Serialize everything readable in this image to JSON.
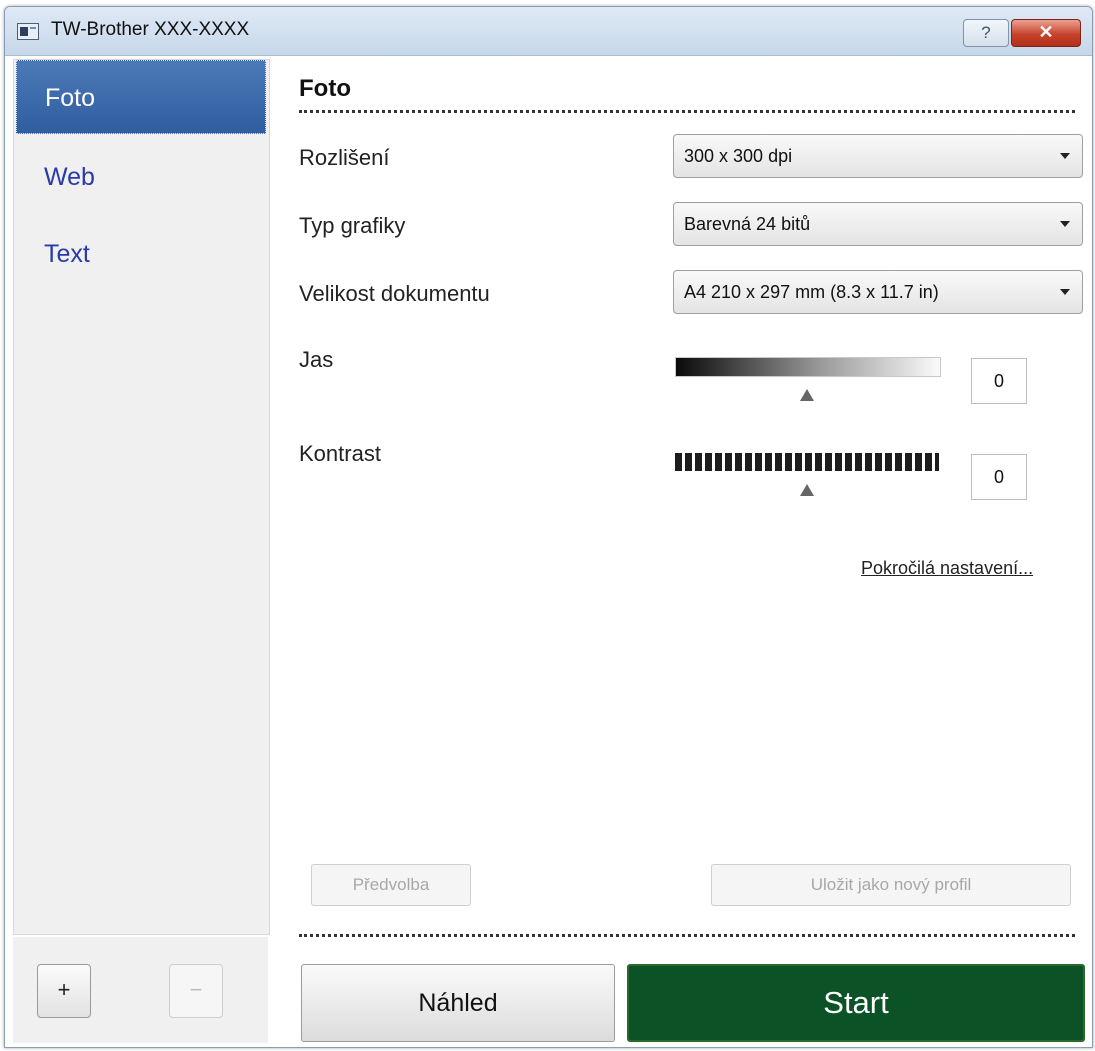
{
  "window": {
    "title": "TW-Brother XXX-XXXX",
    "help_label": "?",
    "close_label": "✕"
  },
  "sidebar": {
    "items": [
      {
        "label": "Foto",
        "active": true
      },
      {
        "label": "Web",
        "active": false
      },
      {
        "label": "Text",
        "active": false
      }
    ],
    "add_label": "+",
    "remove_label": "−"
  },
  "main": {
    "section_title": "Foto",
    "resolution": {
      "label": "Rozlišení",
      "value": "300 x 300 dpi"
    },
    "graphics_type": {
      "label": "Typ grafiky",
      "value": "Barevná 24 bitů"
    },
    "document_size": {
      "label": "Velikost dokumentu",
      "value": "A4 210 x 297 mm (8.3 x 11.7 in)"
    },
    "brightness": {
      "label": "Jas",
      "value": "0",
      "level_fraction": 0.5
    },
    "contrast": {
      "label": "Kontrast",
      "value": "0",
      "level_fraction": 0.5
    },
    "advanced_link": "Pokročilá nastavení...",
    "preset_label": "Předvolba",
    "save_profile_label": "Uložit jako nový profil",
    "preview_label": "Náhled",
    "start_label": "Start"
  },
  "colors": {
    "start_bg": "#0b5227",
    "active_nav_bg": "#2f5d9e",
    "nav_text": "#2a3aa8"
  }
}
